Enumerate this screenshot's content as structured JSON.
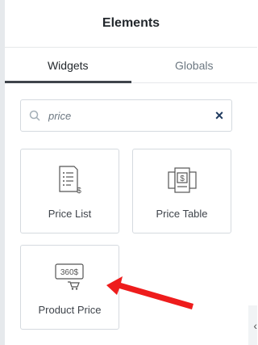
{
  "panel": {
    "title": "Elements",
    "tabs": [
      {
        "label": "Widgets",
        "active": true
      },
      {
        "label": "Globals",
        "active": false
      }
    ]
  },
  "search": {
    "value": "price",
    "icon": "search-icon",
    "clear_icon": "close-icon",
    "clear_symbol": "×"
  },
  "widgets": [
    {
      "label": "Price List",
      "icon": "price-list-icon"
    },
    {
      "label": "Price Table",
      "icon": "price-table-icon"
    },
    {
      "label": "Product Price",
      "icon": "product-price-icon",
      "icon_text": "360$"
    }
  ],
  "collapse_symbol": "‹",
  "colors": {
    "annotation_arrow": "#ee1c1c",
    "active_tab_underline": "#3f444b",
    "text": "#3f444b"
  }
}
